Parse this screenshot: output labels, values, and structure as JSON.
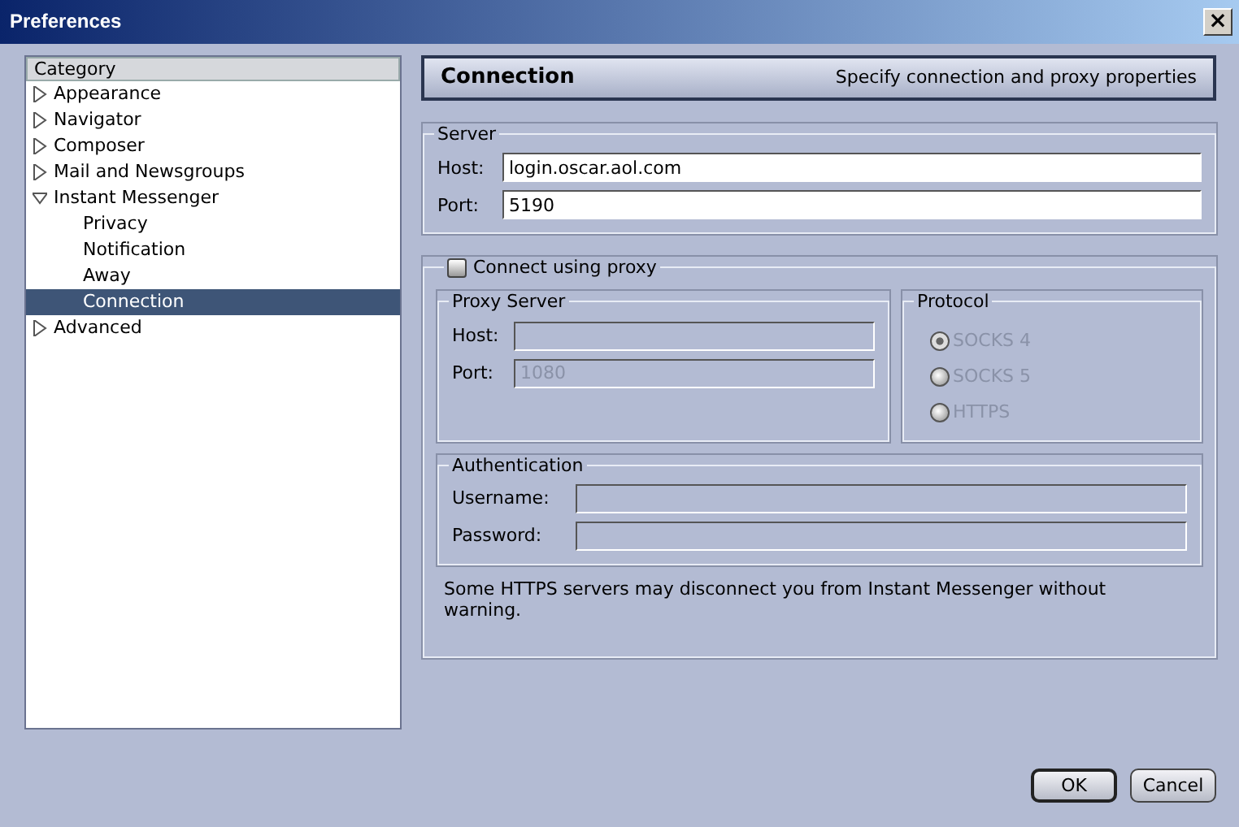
{
  "window": {
    "title": "Preferences",
    "close": "×"
  },
  "sidebar": {
    "header": "Category",
    "items": [
      {
        "label": "Appearance",
        "expanded": false,
        "selected": false
      },
      {
        "label": "Navigator",
        "expanded": false,
        "selected": false
      },
      {
        "label": "Composer",
        "expanded": false,
        "selected": false
      },
      {
        "label": "Mail and Newsgroups",
        "expanded": false,
        "selected": false
      },
      {
        "label": "Instant Messenger",
        "expanded": true,
        "selected": false,
        "children": [
          {
            "label": "Privacy",
            "selected": false
          },
          {
            "label": "Notification",
            "selected": false
          },
          {
            "label": "Away",
            "selected": false
          },
          {
            "label": "Connection",
            "selected": true
          }
        ]
      },
      {
        "label": "Advanced",
        "expanded": false,
        "selected": false
      }
    ]
  },
  "panel": {
    "title": "Connection",
    "subtitle": "Specify connection and proxy properties"
  },
  "server": {
    "legend": "Server",
    "fields": [
      {
        "label": "Host:",
        "value": "login.oscar.aol.com",
        "disabled": false
      },
      {
        "label": "Port:",
        "value": "5190",
        "disabled": false
      }
    ]
  },
  "proxy": {
    "label": "Connect using proxy",
    "checked": false,
    "proxy_server": {
      "legend": "Proxy Server",
      "fields": [
        {
          "label": "Host:",
          "disabled": true
        },
        {
          "label": "Port:",
          "value": "1080",
          "disabled": true
        }
      ]
    },
    "protocol": {
      "legend": "Protocol",
      "options": [
        {
          "label": "SOCKS 4",
          "selected": true,
          "disabled": true
        },
        {
          "label": "SOCKS 5",
          "selected": false,
          "disabled": true
        },
        {
          "label": "HTTPS",
          "selected": false,
          "disabled": true
        }
      ]
    },
    "authentication": {
      "legend": "Authentication",
      "fields": [
        {
          "label": "Username:",
          "disabled": true
        },
        {
          "label": "Password:",
          "disabled": true
        }
      ]
    },
    "note": "Some HTTPS servers may disconnect you from Instant Messenger without warning."
  },
  "buttons": [
    {
      "label": "OK",
      "default": true
    },
    {
      "label": "Cancel",
      "default": false
    }
  ]
}
